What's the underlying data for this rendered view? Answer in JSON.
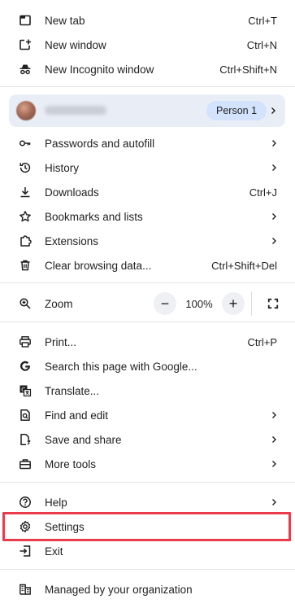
{
  "menu": {
    "group1": [
      {
        "label": "New tab",
        "shortcut": "Ctrl+T",
        "icon": "new-tab-icon"
      },
      {
        "label": "New window",
        "shortcut": "Ctrl+N",
        "icon": "new-window-icon"
      },
      {
        "label": "New Incognito window",
        "shortcut": "Ctrl+Shift+N",
        "icon": "incognito-icon"
      }
    ],
    "profile": {
      "badge": "Person 1"
    },
    "group2": [
      {
        "label": "Passwords and autofill",
        "icon": "key-icon"
      },
      {
        "label": "History",
        "icon": "history-icon"
      },
      {
        "label": "Downloads",
        "shortcut": "Ctrl+J",
        "icon": "download-icon"
      },
      {
        "label": "Bookmarks and lists",
        "icon": "star-icon"
      },
      {
        "label": "Extensions",
        "icon": "puzzle-icon"
      },
      {
        "label": "Clear browsing data...",
        "shortcut": "Ctrl+Shift+Del",
        "icon": "trash-icon"
      }
    ],
    "zoom": {
      "label": "Zoom",
      "value": "100%",
      "minus": "−",
      "plus": "+",
      "icon": "zoom-icon"
    },
    "group3": [
      {
        "label": "Print...",
        "shortcut": "Ctrl+P",
        "icon": "print-icon"
      },
      {
        "label": "Search this page with Google...",
        "icon": "google-icon"
      },
      {
        "label": "Translate...",
        "icon": "translate-icon"
      },
      {
        "label": "Find and edit",
        "icon": "find-icon"
      },
      {
        "label": "Save and share",
        "icon": "save-share-icon"
      },
      {
        "label": "More tools",
        "icon": "toolbox-icon"
      }
    ],
    "group4": [
      {
        "label": "Help",
        "icon": "help-icon"
      },
      {
        "label": "Settings",
        "icon": "gear-icon"
      },
      {
        "label": "Exit",
        "icon": "exit-icon"
      }
    ],
    "managed": {
      "label": "Managed by your organization",
      "icon": "building-icon"
    },
    "highlight_color": "#e83c4d"
  }
}
